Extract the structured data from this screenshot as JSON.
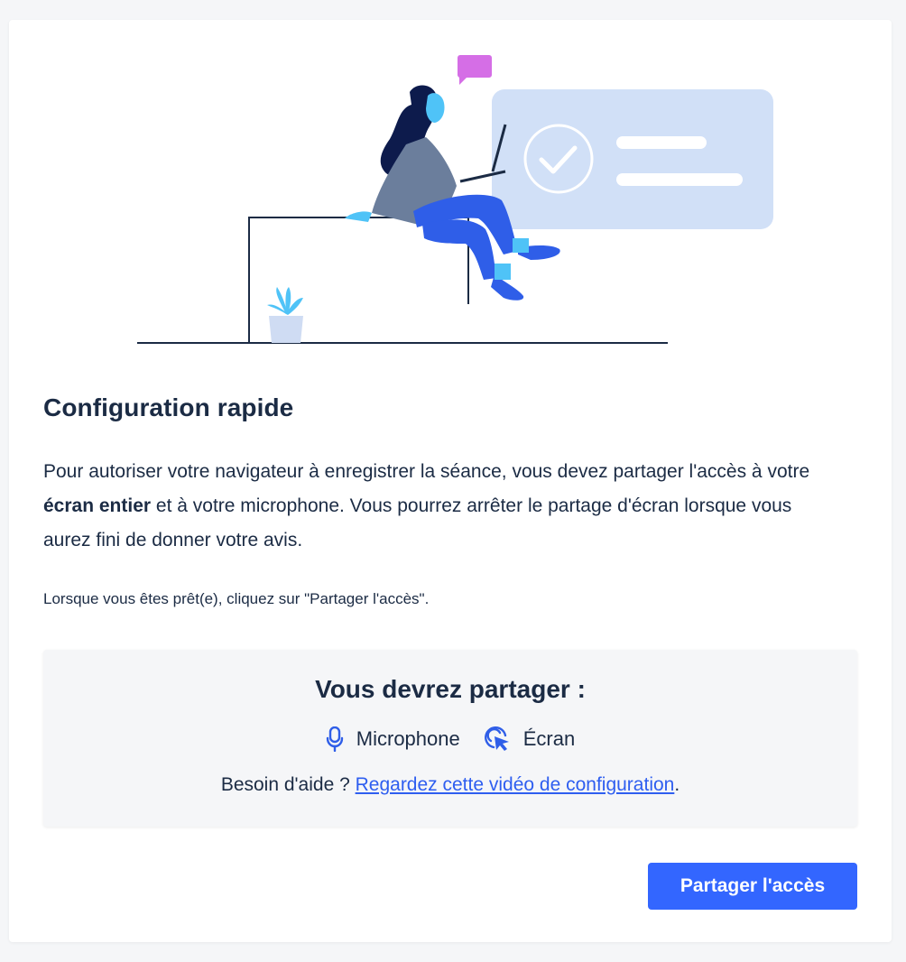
{
  "setup": {
    "title": "Configuration rapide",
    "intro_part1": "Pour autoriser votre navigateur à enregistrer la séance, vous devez partager l'accès à votre ",
    "intro_bold": "écran entier",
    "intro_part2": " et à votre microphone. Vous pourrez arrêter le partage d'écran lorsque vous aurez fini de donner votre avis.",
    "ready_text": "Lorsque vous êtes prêt(e), cliquez sur \"Partager l'accès\"."
  },
  "share_box": {
    "title": "Vous devrez partager :",
    "items": [
      {
        "label": "Microphone",
        "icon": "microphone-icon"
      },
      {
        "label": "Écran",
        "icon": "screen-cursor-icon"
      }
    ],
    "help_prefix": "Besoin d'aide ? ",
    "help_link": "Regardez cette vidéo de configuration",
    "help_suffix": "."
  },
  "actions": {
    "share_button": "Partager l'accès"
  },
  "colors": {
    "primary": "#3366ff",
    "text": "#1b2b44",
    "link": "#2e5ef0",
    "background": "#f5f6f8"
  }
}
